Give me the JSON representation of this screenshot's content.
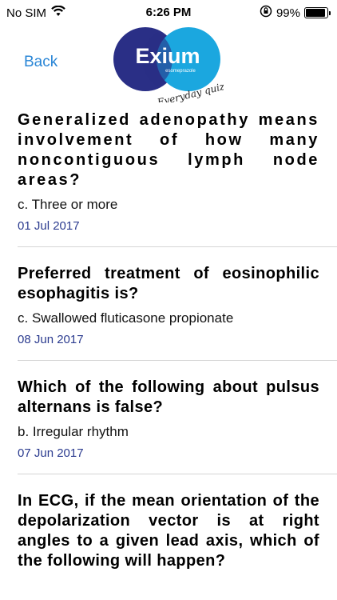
{
  "status_bar": {
    "carrier": "No SIM",
    "time": "6:26 PM",
    "battery_percent": "99%",
    "battery_level": 0.99,
    "icons": [
      "wifi-icon",
      "rotation-lock-icon",
      "battery-icon"
    ]
  },
  "nav": {
    "back_label": "Back",
    "logo_text": "Exium",
    "logo_subtext": "esomeprazole",
    "logo_tagline": "Everyday quiz",
    "logo_colors": {
      "left": "#2a2f86",
      "right": "#1ba7df"
    }
  },
  "questions": [
    {
      "question": "Generalized adenopathy means involvement of how many noncontiguous lymph node areas?",
      "answer": "c. Three or more",
      "date": "01 Jul 2017"
    },
    {
      "question": "Preferred treatment of eosinophilic esophagitis is?",
      "answer": "c. Swallowed fluticasone propionate",
      "date": "08 Jun 2017"
    },
    {
      "question": "Which of the following about pulsus alternans is false?",
      "answer": "b. Irregular rhythm",
      "date": "07 Jun 2017"
    },
    {
      "question": "In ECG, if the mean orientation of the depolarization vector is at right angles to a given lead axis, which of the following will happen?"
    }
  ],
  "colors": {
    "accent": "#2a86d6",
    "date": "#2b3b8f",
    "divider": "#d5d5d5"
  }
}
